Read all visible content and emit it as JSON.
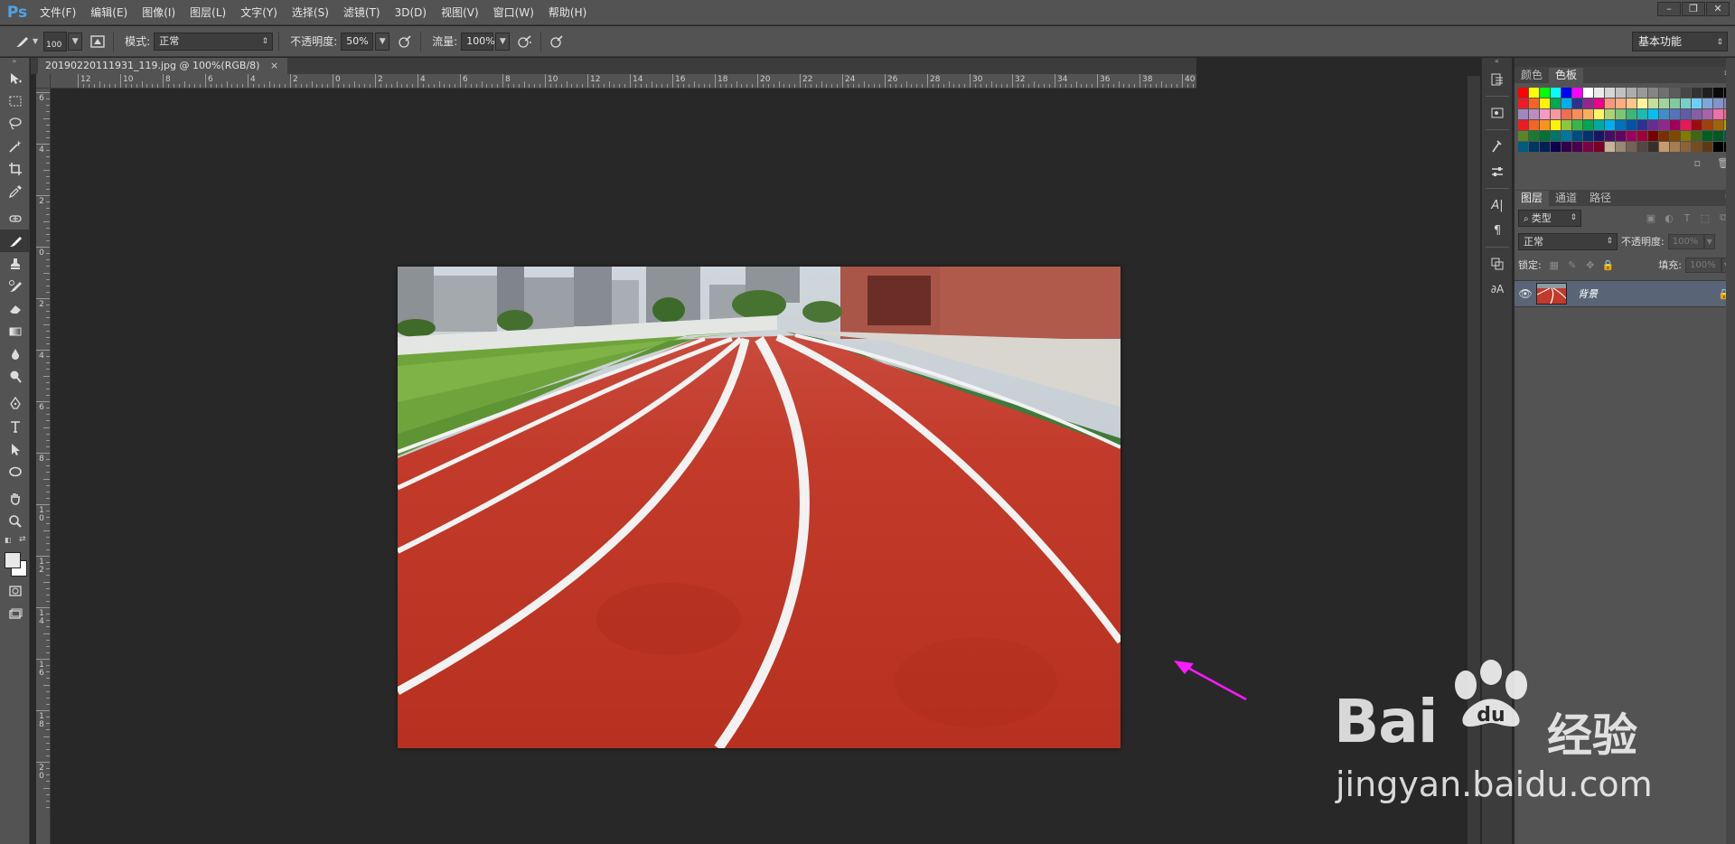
{
  "app": {
    "logo": "Ps"
  },
  "menu": [
    "文件(F)",
    "编辑(E)",
    "图像(I)",
    "图层(L)",
    "文字(Y)",
    "选择(S)",
    "滤镜(T)",
    "3D(D)",
    "视图(V)",
    "窗口(W)",
    "帮助(H)"
  ],
  "options": {
    "brush_size": "100",
    "mode_label": "模式:",
    "mode_value": "正常",
    "opacity_label": "不透明度:",
    "opacity_value": "50%",
    "flow_label": "流量:",
    "flow_value": "100%",
    "workspace": "基本功能"
  },
  "document": {
    "tab_title": "20190220111931_119.jpg @ 100%(RGB/8)",
    "tab_close": "×"
  },
  "rulers": {
    "horizontal": [
      "12",
      "10",
      "8",
      "6",
      "4",
      "2",
      "0",
      "2",
      "4",
      "6",
      "8",
      "10",
      "12",
      "14",
      "16",
      "18",
      "20",
      "22",
      "24",
      "26",
      "28",
      "30",
      "32",
      "34",
      "36",
      "38",
      "40"
    ],
    "vertical": [
      "6",
      "4",
      "2",
      "0",
      "2",
      "4",
      "6",
      "8",
      "10",
      "12",
      "14",
      "16",
      "18",
      "20"
    ]
  },
  "color_panel": {
    "tabs": [
      "颜色",
      "色板"
    ],
    "active_tab": "色板"
  },
  "swatches": [
    "#ff0000",
    "#ffff00",
    "#00ff00",
    "#00ffff",
    "#0000ff",
    "#ff00ff",
    "#ffffff",
    "#ebebeb",
    "#d6d6d6",
    "#c2c2c2",
    "#adadad",
    "#999999",
    "#858585",
    "#707070",
    "#5c5c5c",
    "#474747",
    "#333333",
    "#1f1f1f",
    "#0a0a0a",
    "#000000",
    "#ed1c24",
    "#f26522",
    "#fff200",
    "#00a651",
    "#00aeef",
    "#2e3192",
    "#92278f",
    "#ec008c",
    "#f7977a",
    "#f9ad81",
    "#fdc68a",
    "#fff79a",
    "#c4df9b",
    "#a3d39c",
    "#82ca9d",
    "#7bcdc8",
    "#6ecff6",
    "#7ea7d8",
    "#8493ca",
    "#8882be",
    "#a187be",
    "#bc8dbf",
    "#f49ac2",
    "#f6989d",
    "#f26c4f",
    "#f68e55",
    "#fbaf5c",
    "#fff467",
    "#acd372",
    "#7cc576",
    "#3bb878",
    "#1abbb4",
    "#00bff3",
    "#438ccb",
    "#5574b9",
    "#605ca8",
    "#855fa8",
    "#a763a8",
    "#f06eaa",
    "#f26d7d",
    "#ed1c24",
    "#f26522",
    "#f7941d",
    "#fff200",
    "#8dc63f",
    "#39b54a",
    "#00a651",
    "#00a99d",
    "#00aeef",
    "#0072bc",
    "#0054a6",
    "#2e3192",
    "#662d91",
    "#92278f",
    "#9e005d",
    "#ed145b",
    "#9e0b0f",
    "#a0410d",
    "#a36209",
    "#aba000",
    "#598527",
    "#1a7b30",
    "#007236",
    "#00746b",
    "#0076a3",
    "#004b80",
    "#003471",
    "#1b1464",
    "#440e62",
    "#630460",
    "#9e005d",
    "#9e0039",
    "#790000",
    "#7b2e00",
    "#7d4900",
    "#827b00",
    "#406618",
    "#005e20",
    "#005826",
    "#005952",
    "#005b7f",
    "#003663",
    "#002157",
    "#0d004c",
    "#32004b",
    "#4b0049",
    "#7b0046",
    "#7a0026",
    "#c7b299",
    "#998675",
    "#736357",
    "#534741",
    "#37302a",
    "#c69c6d",
    "#a67c52",
    "#8c6239",
    "#754c24",
    "#603913",
    "#000000",
    "#000000"
  ],
  "layers_panel": {
    "tabs": [
      "图层",
      "通道",
      "路径"
    ],
    "active_tab": "图层",
    "filter_label": "类型",
    "blend_mode": "正常",
    "opacity_label": "不透明度:",
    "opacity_value": "100%",
    "lock_label": "锁定:",
    "fill_label": "填充:",
    "fill_value": "100%",
    "layer_name": "背景"
  },
  "watermark": {
    "brand": "Bai",
    "brand_cn": "经验",
    "url": "jingyan.baidu.com"
  },
  "colors": {
    "arrow": "#ff1aff",
    "track": "#c4301f",
    "accent_selection": "#596577"
  }
}
